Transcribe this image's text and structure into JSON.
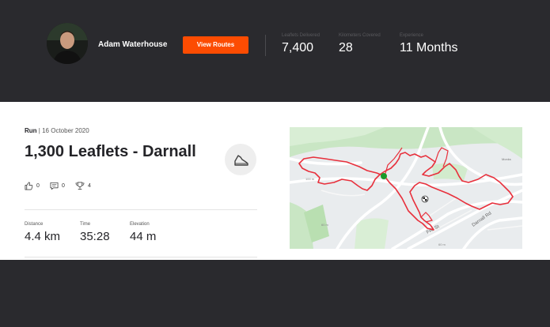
{
  "header": {
    "athlete_name": "Adam Waterhouse",
    "view_routes_label": "View Routes",
    "stats": [
      {
        "label": "Leaflets Delivered",
        "value": "7,400"
      },
      {
        "label": "Kilometers Covered",
        "value": "28"
      },
      {
        "label": "Experience",
        "value": "11 Months"
      }
    ]
  },
  "activity": {
    "type": "Run",
    "date": "16 October 2020",
    "title": "1,300 Leaflets - Darnall",
    "kudos": "0",
    "comments": "0",
    "achievements": "4",
    "metrics": [
      {
        "label": "Distance",
        "value": "4.4 km"
      },
      {
        "label": "Time",
        "value": "35:28"
      },
      {
        "label": "Elevation",
        "value": "44 m"
      }
    ]
  },
  "map": {
    "street_labels": [
      "Fife St",
      "Darnall Rd",
      "Monks",
      "100 m",
      "60 m",
      "60 m"
    ],
    "route_color": "#e8303c",
    "start_color": "#1a9a2a"
  }
}
